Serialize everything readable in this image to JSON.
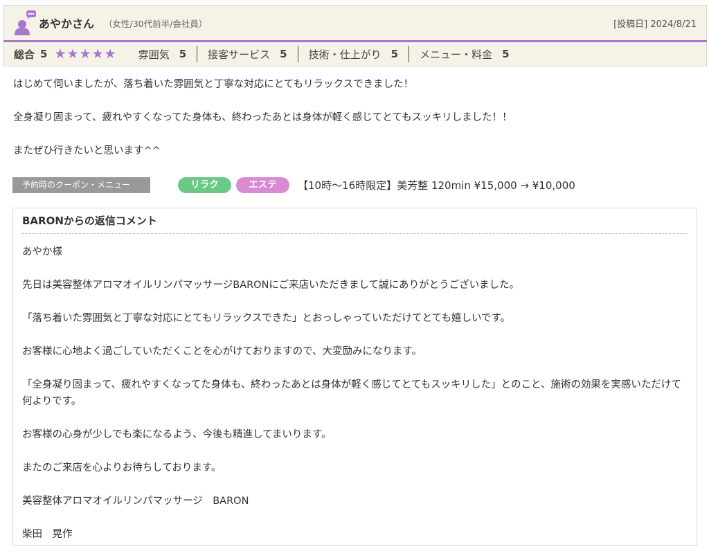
{
  "reviewer": {
    "name": "あやかさん",
    "meta": "（女性/30代前半/会社員）",
    "post_date": "[投稿日] 2024/8/21"
  },
  "ratings": {
    "overall_label": "総合",
    "overall_score": "5",
    "star_count": 5,
    "star_color": "#a678cc",
    "items": [
      {
        "label": "雰囲気",
        "value": "5"
      },
      {
        "label": "接客サービス",
        "value": "5"
      },
      {
        "label": "技術・仕上がり",
        "value": "5"
      },
      {
        "label": "メニュー・料金",
        "value": "5"
      }
    ]
  },
  "review_body": [
    "はじめて伺いましたが、落ち着いた雰囲気と丁寧な対応にとてもリラックスできました！",
    "全身凝り固まって、疲れやすくなってた身体も、終わったあとは身体が軽く感じてとてもスッキリしました！！",
    "またぜひ行きたいと思います^^"
  ],
  "coupon": {
    "label": "予約時のクーポン・メニュー",
    "tags": [
      "リラク",
      "エステ"
    ],
    "text": "【10時～16時限定】美芳整 120min ¥15,000 → ¥10,000"
  },
  "reply": {
    "title": "BARONからの返信コメント",
    "paragraphs": [
      "あやか様",
      "先日は美容整体アロマオイルリンパマッサージBARONにご来店いただきまして誠にありがとうございました。",
      "「落ち着いた雰囲気と丁寧な対応にとてもリラックスできた」とおっしゃっていただけてとても嬉しいです。",
      "お客様に心地よく過ごしていただくことを心がけておりますので、大変励みになります。",
      "「全身凝り固まって、疲れやすくなってた身体も、終わったあとは身体が軽く感じてとてもスッキリした」とのこと、施術の効果を実感いただけて何よりです。",
      "お客様の心身が少しでも楽になるよう、今後も精進してまいります。",
      "またのご来店を心よりお待ちしております。",
      "美容整体アロマオイルリンパマッサージ　BARON",
      "柴田　晃作"
    ]
  }
}
